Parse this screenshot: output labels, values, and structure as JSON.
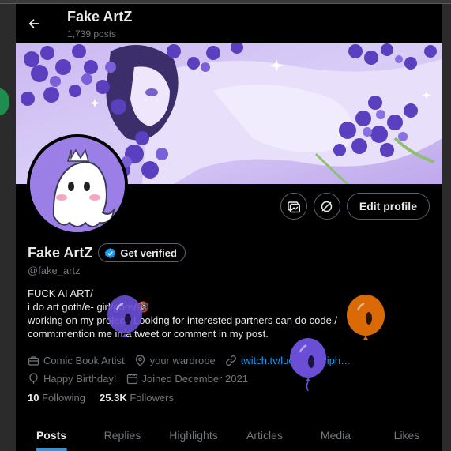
{
  "header": {
    "title": "Fake ArtZ",
    "posts_count": "1,739 posts"
  },
  "profile": {
    "display_name": "Fake ArtZ",
    "handle": "@fake_artz",
    "verify_label": "Get verified",
    "edit_label": "Edit profile",
    "bio_lines": [
      "FUCK AI ART/",
      "i do art goth/e- girl/gore/🔞",
      "working on my project+Looking for interested partners can do code./",
      "comm:mention me in a tweet or comment in my post."
    ],
    "category": "Comic Book Artist",
    "location": "your wardrobe",
    "website": "twitch.tv/luciferin_ciph…",
    "birthday": "Happy Birthday!",
    "joined": "Joined December 2021",
    "following_count": "10",
    "following_label": "Following",
    "followers_count": "25.3K",
    "followers_label": "Followers"
  },
  "tabs": [
    "Posts",
    "Replies",
    "Highlights",
    "Articles",
    "Media",
    "Likes"
  ],
  "active_tab": "Posts",
  "icons": {
    "back": "arrow-left-icon",
    "media_tag": "image-tag-icon",
    "grok": "grok-icon",
    "verified": "verified-badge-icon",
    "category": "briefcase-icon",
    "location": "location-pin-icon",
    "link": "link-icon",
    "birthday": "balloon-icon",
    "joined": "calendar-icon"
  },
  "colors": {
    "background": "#000000",
    "accent": "#1d9bf0",
    "text_primary": "#e7e9ea",
    "text_secondary": "#71767b",
    "border": "#536471",
    "balloon_purple": "#6a4fd6",
    "balloon_orange": "#d96a06"
  }
}
